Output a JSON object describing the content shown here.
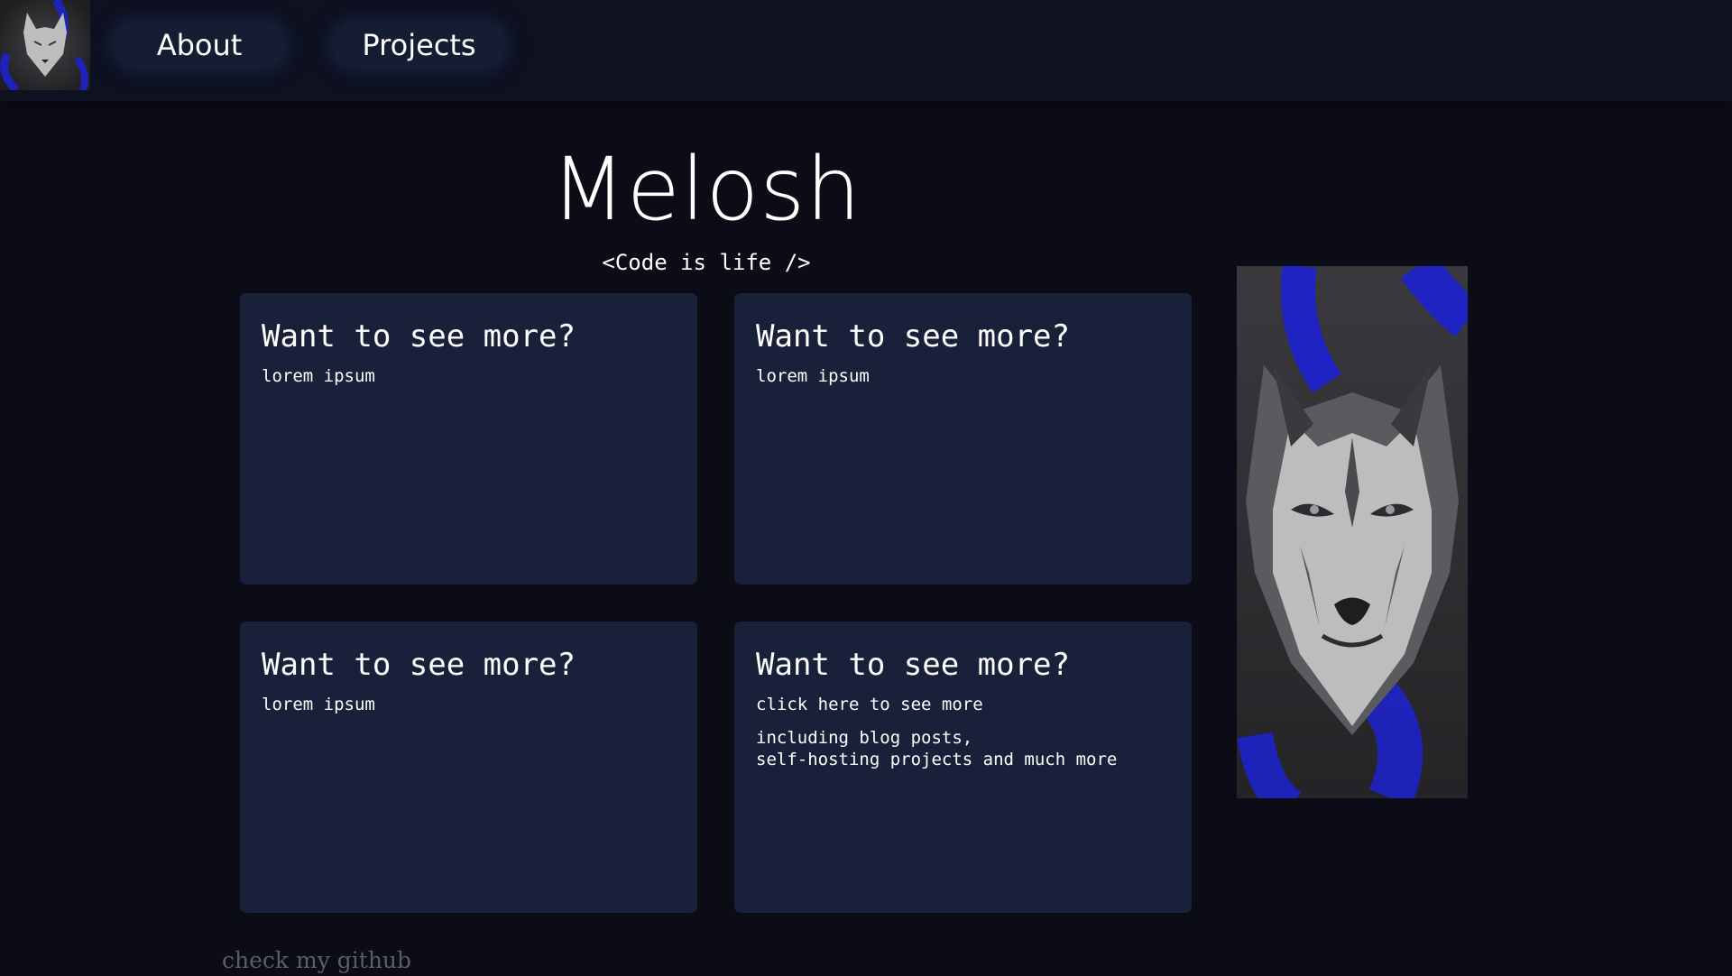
{
  "nav": {
    "logo_icon": "wolf-logo-icon",
    "about_label": "About",
    "projects_label": "Projects"
  },
  "hero": {
    "title": "Melosh",
    "subtitle": "<Code is life />"
  },
  "cards": [
    {
      "title": "Want to see more?",
      "text": "lorem ipsum"
    },
    {
      "title": "Want to see more?",
      "text": "lorem ipsum"
    },
    {
      "title": "Want to see more?",
      "text": "lorem ipsum"
    },
    {
      "title": "Want to see more?",
      "text": "click here to see more",
      "text2": "including blog posts,\nself-hosting projects and much more"
    }
  ],
  "side_image": {
    "icon": "wolf-portrait-icon"
  },
  "footer": {
    "github_label": "check my github"
  },
  "colors": {
    "background": "#0b0c16",
    "navbar": "#0d1120",
    "card": "#19203a",
    "accent_blue": "#1d22c9"
  }
}
